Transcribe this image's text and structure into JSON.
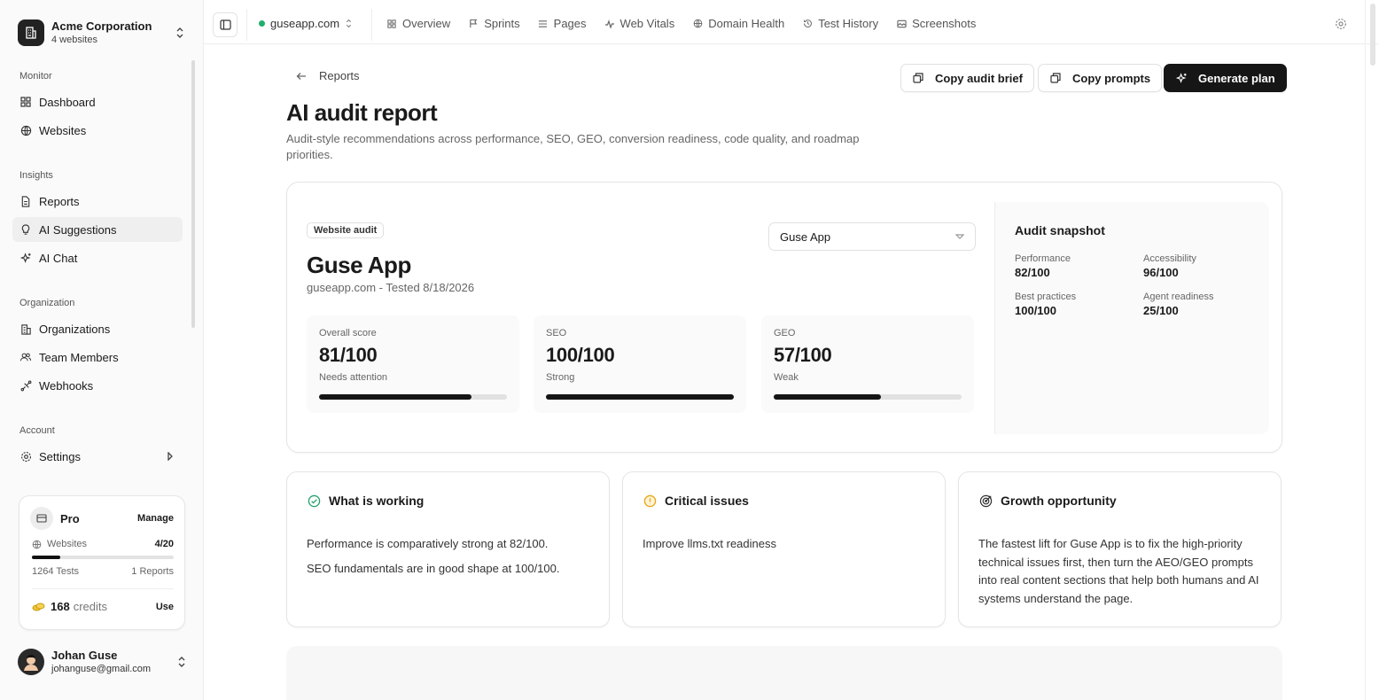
{
  "sidebar": {
    "org": {
      "name": "Acme Corporation",
      "sub": "4 websites"
    },
    "sections": {
      "monitor": "Monitor",
      "insights": "Insights",
      "organization": "Organization",
      "account": "Account"
    },
    "items": {
      "dashboard": "Dashboard",
      "websites": "Websites",
      "reports": "Reports",
      "ai_suggestions": "AI Suggestions",
      "ai_chat": "AI Chat",
      "organizations": "Organizations",
      "team_members": "Team Members",
      "webhooks": "Webhooks",
      "settings": "Settings"
    },
    "active_item": "AI Suggestions",
    "plan": {
      "name": "Pro",
      "manage": "Manage",
      "websites_label": "Websites",
      "websites_value": "4/20",
      "websites_used_fraction": 0.2,
      "tests": "1264 Tests",
      "reports": "1 Reports",
      "credits_value": "168",
      "credits_label": "credits",
      "use": "Use"
    },
    "user": {
      "name": "Johan Guse",
      "email": "johanguse@gmail.com"
    }
  },
  "topbar": {
    "site": "guseapp.com",
    "tabs": [
      "Overview",
      "Sprints",
      "Pages",
      "Web Vitals",
      "Domain Health",
      "Test History",
      "Screenshots"
    ]
  },
  "page": {
    "back_label": "Reports",
    "buttons": {
      "copy_brief": "Copy audit brief",
      "copy_prompts": "Copy prompts",
      "generate": "Generate plan"
    },
    "title": "AI audit report",
    "subtitle": "Audit-style recommendations across performance, SEO, GEO, conversion readiness, code quality, and roadmap priorities."
  },
  "audit": {
    "tag": "Website audit",
    "app_name": "Guse App",
    "meta": "guseapp.com - Tested 8/18/2026",
    "selector_value": "Guse App",
    "scores": [
      {
        "label": "Overall score",
        "value": "81/100",
        "status": "Needs attention",
        "fraction": 0.81
      },
      {
        "label": "SEO",
        "value": "100/100",
        "status": "Strong",
        "fraction": 1.0
      },
      {
        "label": "GEO",
        "value": "57/100",
        "status": "Weak",
        "fraction": 0.57
      }
    ],
    "snapshot": {
      "title": "Audit snapshot",
      "items": [
        {
          "label": "Performance",
          "value": "82/100"
        },
        {
          "label": "Accessibility",
          "value": "96/100"
        },
        {
          "label": "Best practices",
          "value": "100/100"
        },
        {
          "label": "Agent readiness",
          "value": "25/100"
        }
      ]
    }
  },
  "cards": {
    "working": {
      "title": "What is working",
      "lines": [
        "Performance is comparatively strong at 82/100.",
        "SEO fundamentals are in good shape at 100/100."
      ]
    },
    "critical": {
      "title": "Critical issues",
      "lines": [
        "Improve llms.txt readiness"
      ]
    },
    "growth": {
      "title": "Growth opportunity",
      "text": "The fastest lift for Guse App is to fix the high-priority technical issues first, then turn the AEO/GEO prompts into real content sections that help both humans and AI systems understand the page."
    }
  },
  "colors": {
    "accent_dark": "#161616",
    "status_green": "#1faf6c",
    "success_icon": "#22a06b",
    "warning_icon": "#e8a317"
  }
}
